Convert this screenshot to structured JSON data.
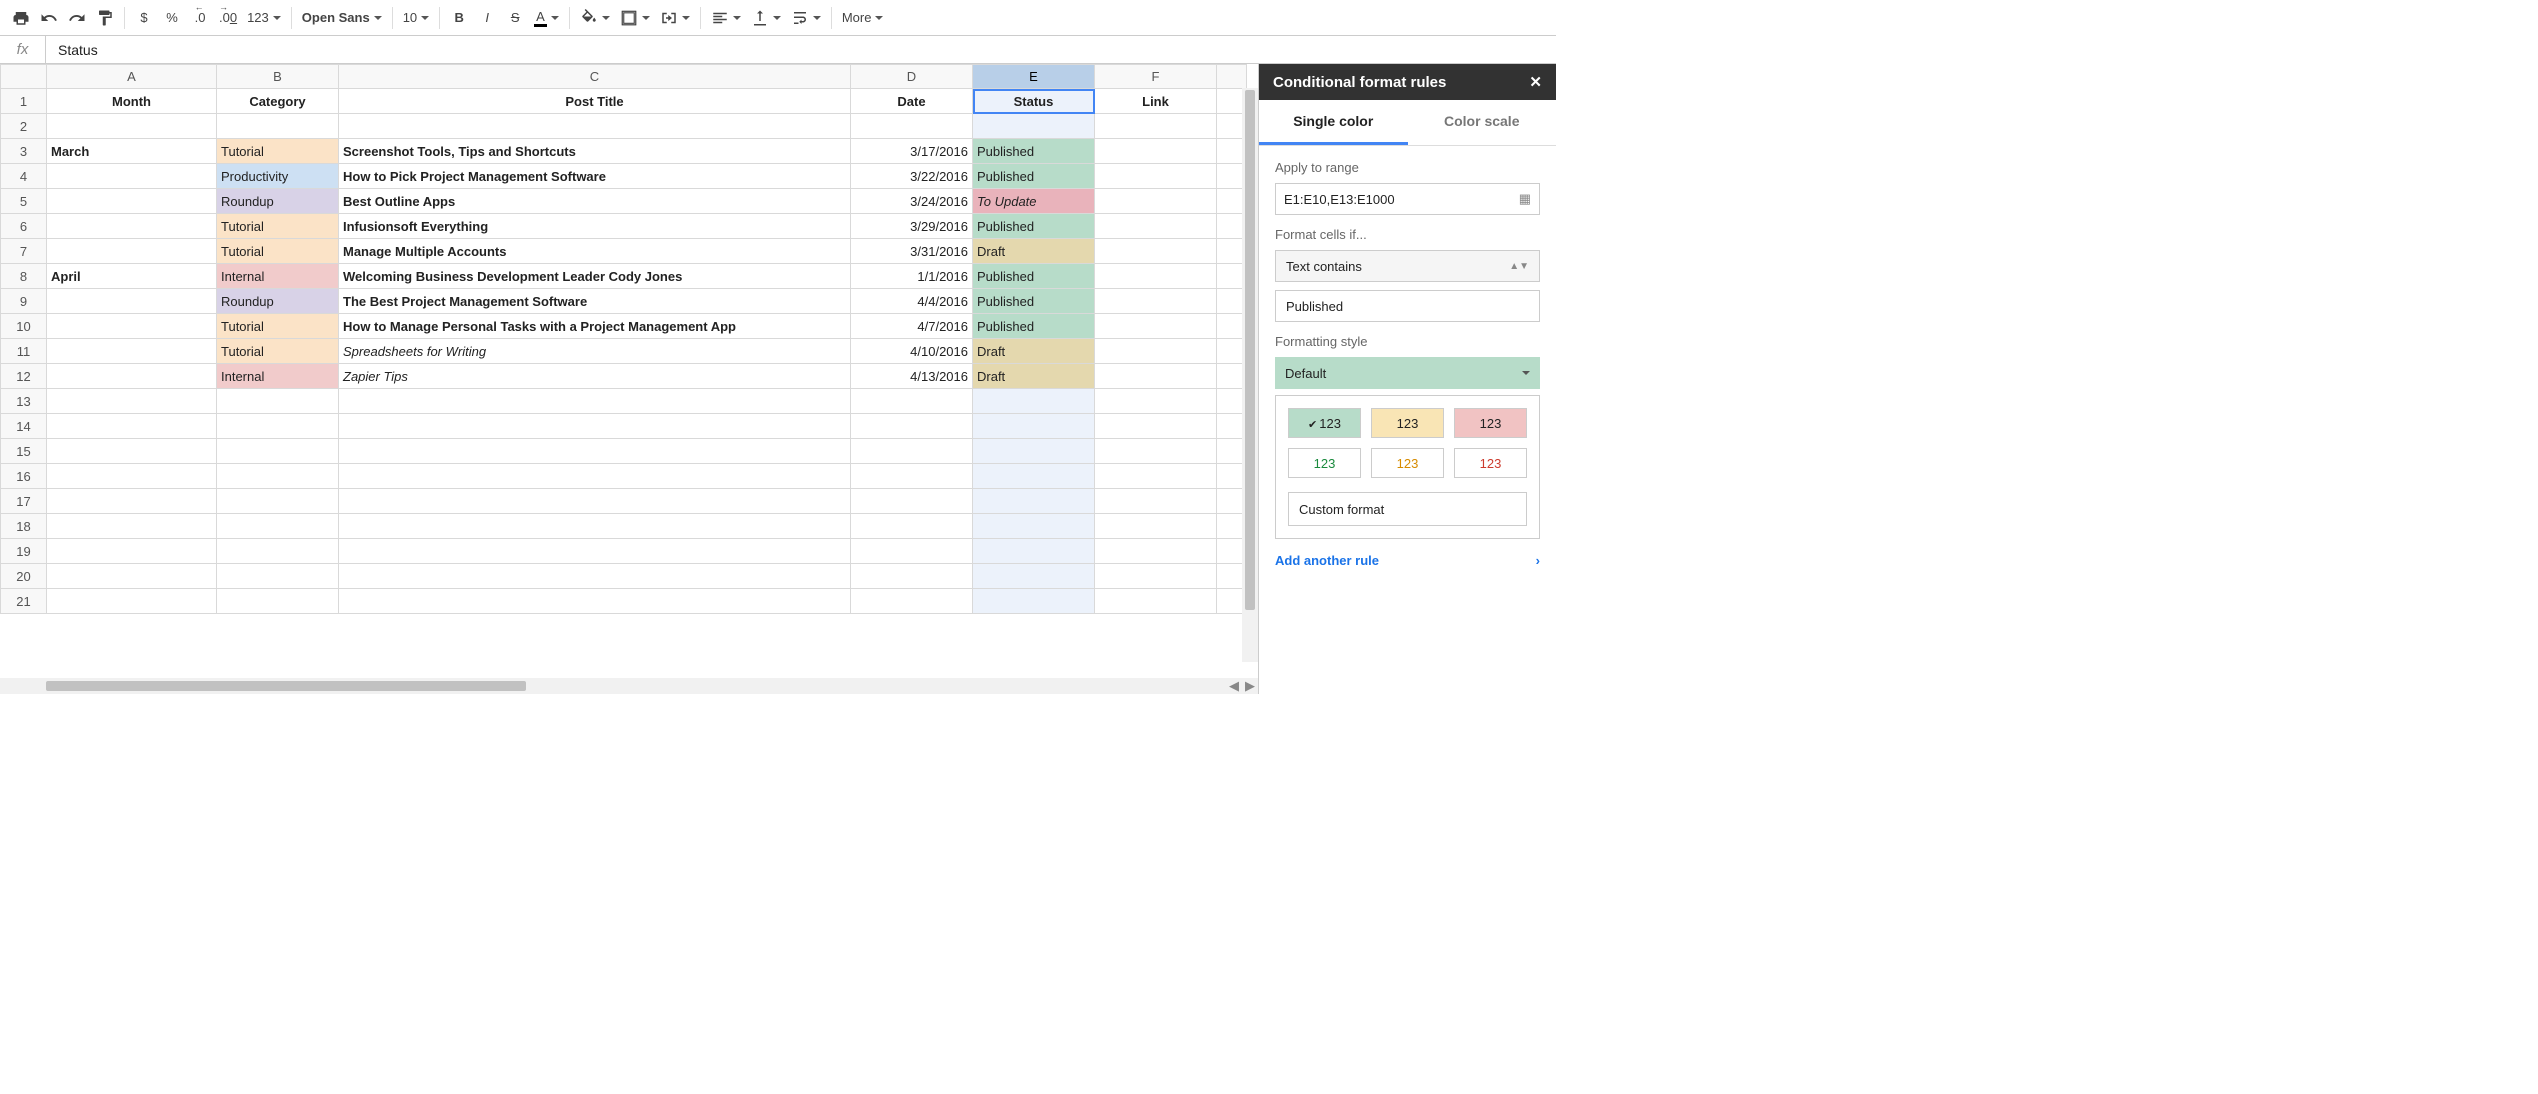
{
  "toolbar": {
    "currency": "$",
    "percent": "%",
    "dec_dec": ".0",
    "dec_inc": ".00",
    "numfmt": "123",
    "font": "Open Sans",
    "size": "10",
    "bold": "B",
    "italic": "I",
    "strike": "S",
    "underline_a": "A",
    "more": "More"
  },
  "formula": {
    "fx": "fx",
    "value": "Status"
  },
  "columns": [
    "A",
    "B",
    "C",
    "D",
    "E",
    "F"
  ],
  "headers": {
    "a": "Month",
    "b": "Category",
    "c": "Post Title",
    "d": "Date",
    "e": "Status",
    "f": "Link"
  },
  "rows": [
    {
      "n": 1,
      "header": true
    },
    {
      "n": 2
    },
    {
      "n": 3,
      "month": "March",
      "cat": "Tutorial",
      "catc": "tutorial",
      "title": "Screenshot Tools, Tips and Shortcuts",
      "date": "3/17/2016",
      "status": "Published",
      "stc": "published"
    },
    {
      "n": 4,
      "cat": "Productivity",
      "catc": "productivity",
      "title": "How to Pick Project Management Software",
      "date": "3/22/2016",
      "status": "Published",
      "stc": "published"
    },
    {
      "n": 5,
      "cat": "Roundup",
      "catc": "roundup",
      "title": "Best Outline Apps",
      "date": "3/24/2016",
      "status": "To Update",
      "stc": "toupdate",
      "stItalic": true
    },
    {
      "n": 6,
      "cat": "Tutorial",
      "catc": "tutorial",
      "title": "Infusionsoft Everything",
      "date": "3/29/2016",
      "status": "Published",
      "stc": "published"
    },
    {
      "n": 7,
      "cat": "Tutorial",
      "catc": "tutorial",
      "title": "Manage Multiple Accounts",
      "date": "3/31/2016",
      "status": "Draft",
      "stc": "draft"
    },
    {
      "n": 8,
      "month": "April",
      "cat": "Internal",
      "catc": "internal",
      "title": "Welcoming Business Development Leader Cody Jones",
      "date": "1/1/2016",
      "status": "Published",
      "stc": "published"
    },
    {
      "n": 9,
      "cat": "Roundup",
      "catc": "roundup",
      "title": "The Best Project Management Software",
      "date": "4/4/2016",
      "status": "Published",
      "stc": "published"
    },
    {
      "n": 10,
      "cat": "Tutorial",
      "catc": "tutorial",
      "title": "How to Manage Personal Tasks with a Project Management App",
      "date": "4/7/2016",
      "status": "Published",
      "stc": "published"
    },
    {
      "n": 11,
      "cat": "Tutorial",
      "catc": "tutorial",
      "title": "Spreadsheets for Writing",
      "titleItalic": true,
      "date": "4/10/2016",
      "status": "Draft",
      "stc": "draft"
    },
    {
      "n": 12,
      "cat": "Internal",
      "catc": "internal",
      "title": "Zapier Tips",
      "titleItalic": true,
      "date": "4/13/2016",
      "status": "Draft",
      "stc": "draft"
    },
    {
      "n": 13
    },
    {
      "n": 14
    },
    {
      "n": 15
    },
    {
      "n": 16
    },
    {
      "n": 17
    },
    {
      "n": 18
    },
    {
      "n": 19
    },
    {
      "n": 20
    },
    {
      "n": 21
    }
  ],
  "panel": {
    "title": "Conditional format rules",
    "tab1": "Single color",
    "tab2": "Color scale",
    "apply_label": "Apply to range",
    "range": "E1:E10,E13:E1000",
    "format_if": "Format cells if...",
    "condition": "Text contains",
    "condition_value": "Published",
    "style_label": "Formatting style",
    "default": "Default",
    "swatch": "123",
    "custom": "Custom format",
    "add_rule": "Add another rule"
  }
}
